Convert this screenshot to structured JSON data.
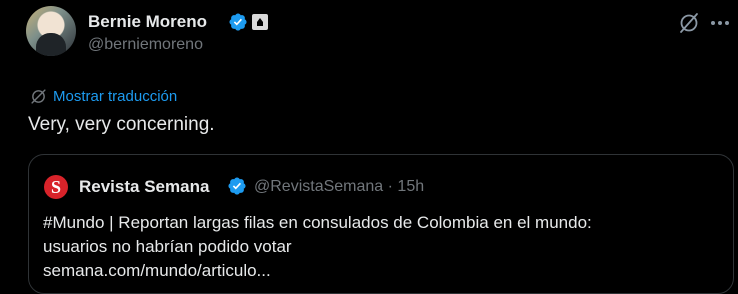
{
  "author": {
    "display_name": "Bernie Moreno",
    "handle": "@berniemoreno"
  },
  "translate_label": "Mostrar traducción",
  "tweet_text": "Very, very concerning.",
  "quoted": {
    "logo_letter": "S",
    "display_name": "Revista Semana",
    "handle": "@RevistaSemana",
    "separator": "·",
    "time": "15h",
    "text_lines": [
      "#Mundo | Reportan largas filas en consulados de Colombia en el mundo:",
      "usuarios no habrían podido votar",
      "semana.com/mundo/articulo..."
    ]
  },
  "icons": {
    "verified": "verified-badge-icon",
    "government": "government-badge-icon",
    "grok": "grok-icon",
    "more": "more-options-icon",
    "translate": "translate-icon"
  },
  "colors": {
    "background": "#000000",
    "text": "#e7e9ea",
    "muted": "#71767b",
    "link": "#1d9bf0",
    "verified": "#1d9bf0",
    "semana_red": "#d8232a",
    "border": "#2f3336"
  }
}
